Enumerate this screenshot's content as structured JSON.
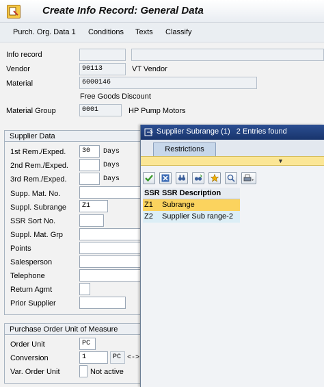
{
  "window": {
    "title": "Create Info Record: General Data"
  },
  "menu": {
    "items": [
      "Purch. Org. Data 1",
      "Conditions",
      "Texts",
      "Classify"
    ]
  },
  "header": {
    "info_record_label": "Info record",
    "info_record_value": "",
    "info_record_desc": "",
    "vendor_label": "Vendor",
    "vendor_value": "90113",
    "vendor_name": "VT Vendor",
    "material_label": "Material",
    "material_value": "6000146",
    "material_desc": "Free Goods Discount",
    "material_group_label": "Material Group",
    "material_group_value": "0001",
    "material_group_desc": "HP Pump Motors"
  },
  "supplier_data": {
    "title": "Supplier Data",
    "rem1_label": "1st Rem./Exped.",
    "rem1_value": "30",
    "rem1_unit": "Days",
    "rem2_label": "2nd Rem./Exped.",
    "rem2_value": "",
    "rem2_unit": "Days",
    "rem3_label": "3rd Rem./Exped.",
    "rem3_value": "",
    "rem3_unit": "Days",
    "supp_mat_no_label": "Supp. Mat. No.",
    "suppl_subrange_label": "Suppl. Subrange",
    "suppl_subrange_value": "Z1",
    "ssr_sort_label": "SSR Sort No.",
    "suppl_mat_grp_label": "Suppl. Mat. Grp",
    "points_label": "Points",
    "salesperson_label": "Salesperson",
    "telephone_label": "Telephone",
    "return_agmt_label": "Return Agmt",
    "prior_supplier_label": "Prior Supplier"
  },
  "po_unit": {
    "title": "Purchase Order Unit of Measure",
    "order_unit_label": "Order Unit",
    "order_unit_value": "PC",
    "conversion_label": "Conversion",
    "conversion_value": "1",
    "conversion_unit": "PC",
    "conversion_arrow": "<->",
    "var_order_unit_label": "Var. Order Unit",
    "var_order_unit_status": "Not active"
  },
  "popup": {
    "title": "Supplier Subrange (1)",
    "entries_found": "2 Entries found",
    "tab_label": "Restrictions",
    "toolbar_icons": [
      "check-icon",
      "cancel-icon",
      "find-icon",
      "find-next-icon",
      "new-entries-icon",
      "help-icon",
      "print-icon"
    ],
    "columns": [
      "SSR",
      "SSR Description"
    ],
    "rows": [
      {
        "code": "Z1",
        "desc": "Subrange"
      },
      {
        "code": "Z2",
        "desc": "Supplier Sub range-2"
      }
    ]
  },
  "colors": {
    "popup_title_bg": "#18346c",
    "highlight_row": "#fbd35e",
    "yellow_bar": "#fbe696",
    "accent_green": "#3a9a2c"
  }
}
